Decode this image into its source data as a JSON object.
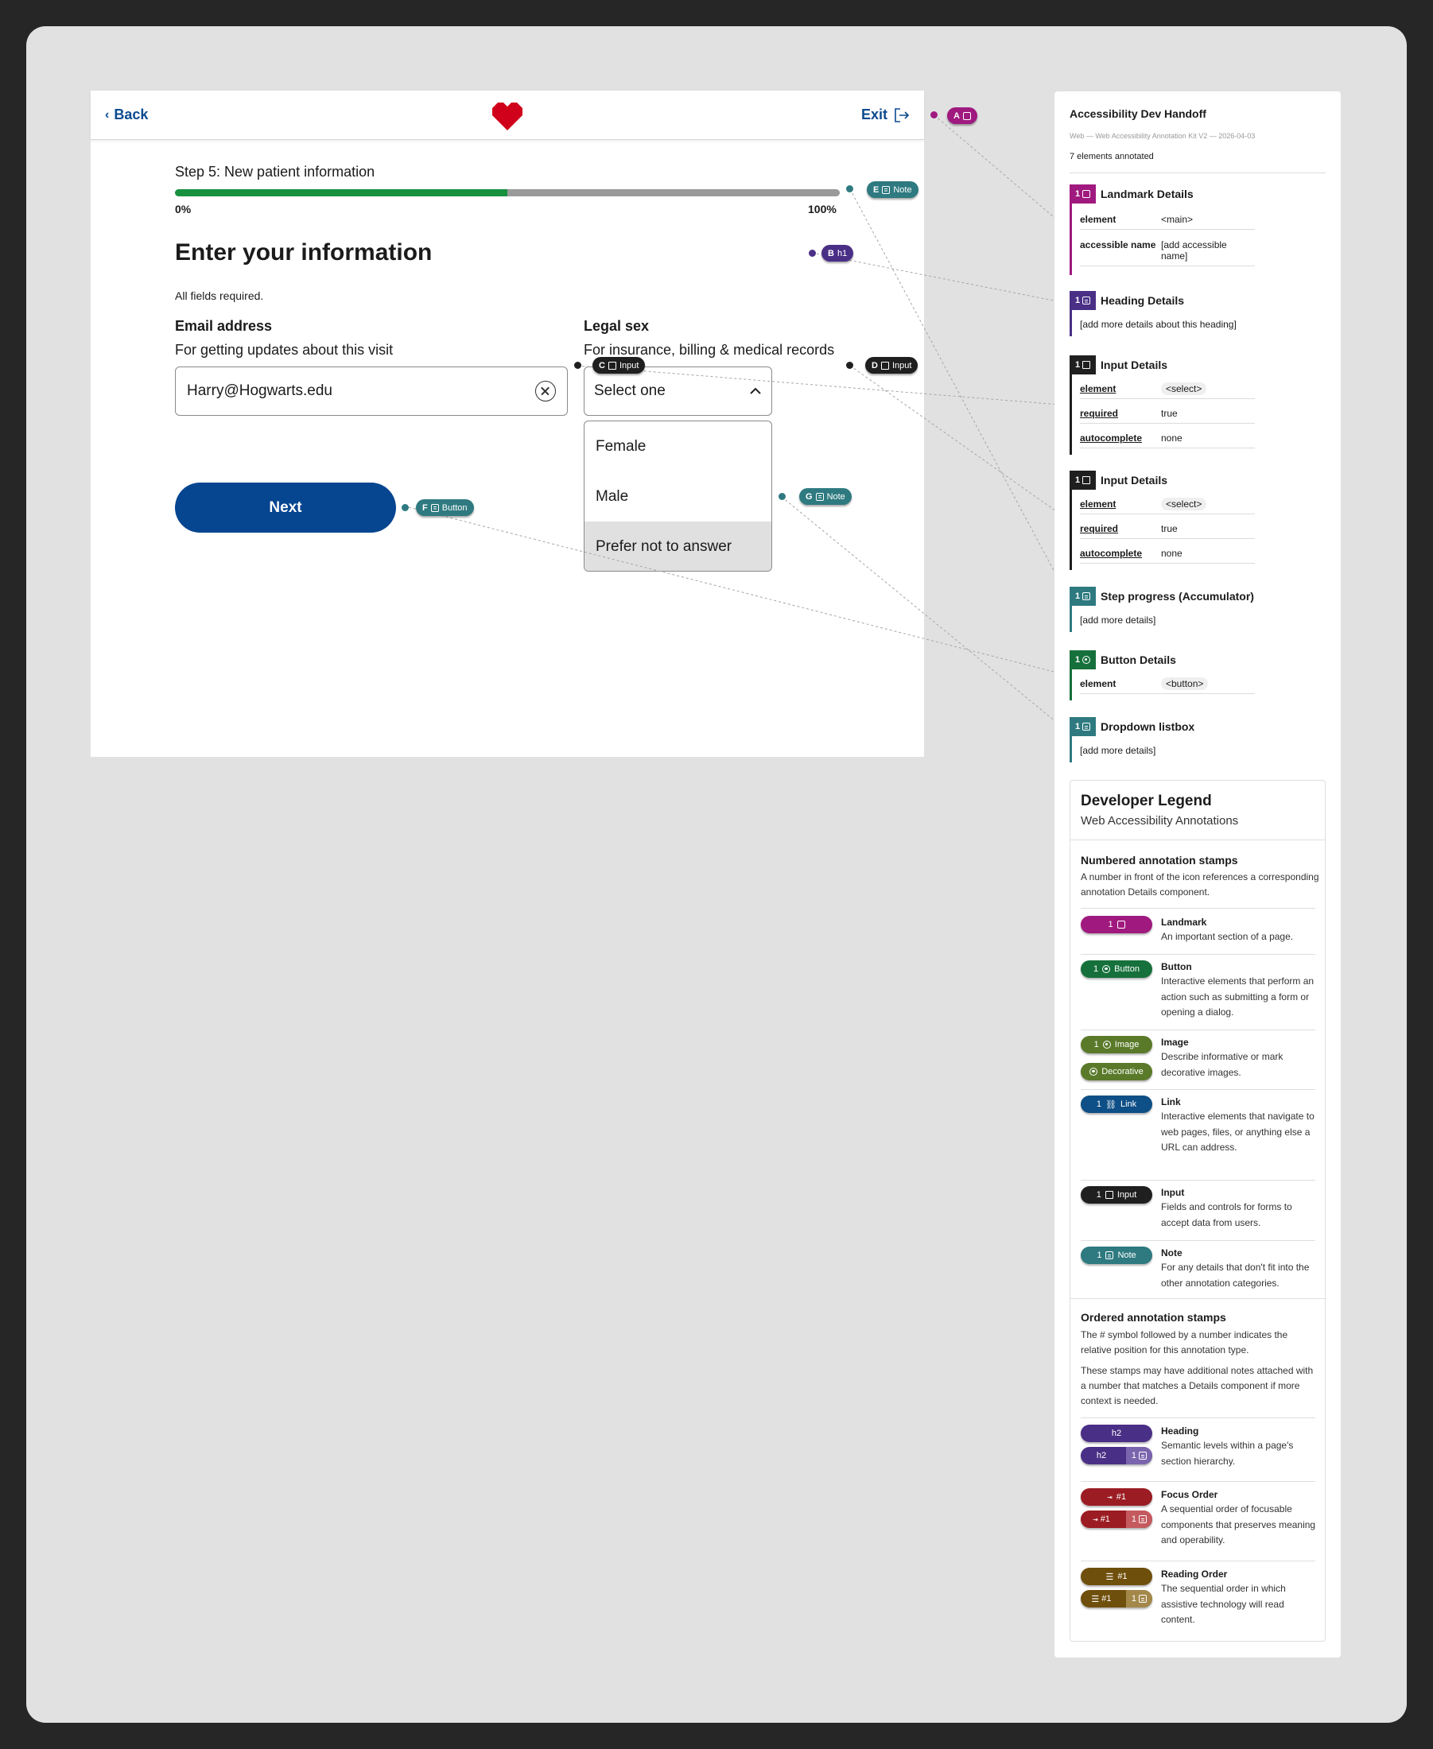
{
  "mock": {
    "back_label": "Back",
    "exit_label": "Exit",
    "step_title": "Step 5: New patient information",
    "progress": 0.5,
    "progress_start": "0%",
    "progress_end": "100%",
    "heading": "Enter your information",
    "required_note": "All fields required.",
    "email": {
      "label": "Email address",
      "hint": "For getting updates about this visit",
      "value": "Harry@Hogwarts.edu"
    },
    "sex": {
      "label": "Legal sex",
      "hint": "For insurance, billing & medical records",
      "selected": "Select one",
      "options": [
        "Female",
        "Male",
        "Prefer not to answer"
      ]
    },
    "next_label": "Next",
    "brand_color": "#d0021b",
    "accent_color": "#064590"
  },
  "stamps": {
    "a": "A",
    "e": {
      "letter": "E",
      "label": "Note"
    },
    "b": {
      "letter": "B",
      "label": "h1"
    },
    "c": {
      "letter": "C",
      "label": "Input"
    },
    "d": {
      "letter": "D",
      "label": "Input"
    },
    "g": {
      "letter": "G",
      "label": "Note"
    },
    "f": {
      "letter": "F",
      "label": "Button"
    }
  },
  "panel": {
    "title": "Accessibility Dev Handoff",
    "subtitle": "Web — Web Accessibility Annotation Kit V2 — 2026-04-03",
    "count": "7 elements annotated",
    "details": [
      {
        "num": "1",
        "title": "Landmark Details",
        "color": "#a0197f",
        "rows": [
          {
            "k": "element",
            "v": "<main>"
          },
          {
            "k": "accessible name",
            "v": "[add accessible name]"
          }
        ]
      },
      {
        "num": "1",
        "title": "Heading Details",
        "color": "#4a2f86",
        "text": "[add more details about this heading]"
      },
      {
        "num": "1",
        "title": "Input Details",
        "color": "#1f1f1f",
        "rows": [
          {
            "k": "element",
            "v": "<select>"
          },
          {
            "k": "required",
            "v": "true"
          },
          {
            "k": "autocomplete",
            "v": "none"
          }
        ]
      },
      {
        "num": "1",
        "title": "Input Details",
        "color": "#1f1f1f",
        "rows": [
          {
            "k": "element",
            "v": "<select>"
          },
          {
            "k": "required",
            "v": "true"
          },
          {
            "k": "autocomplete",
            "v": "none"
          }
        ]
      },
      {
        "num": "1",
        "title": "Step progress (Accumulator)",
        "color": "#2e7a80",
        "text": "[add more details]"
      },
      {
        "num": "1",
        "title": "Button Details",
        "color": "#16703b",
        "rows": [
          {
            "k": "element",
            "v": "<button>"
          }
        ]
      },
      {
        "num": "1",
        "title": "Dropdown listbox",
        "color": "#2e7a80",
        "text": "[add more details]"
      }
    ]
  },
  "legend": {
    "title": "Developer Legend",
    "subtitle": "Web Accessibility Annotations",
    "numbered_title": "Numbered annotation stamps",
    "numbered_text": "A number in front of the icon references a corresponding annotation Details component.",
    "items": [
      {
        "stamp": "1",
        "stamp_label": "",
        "label": "Landmark",
        "desc": "An important section of a page.",
        "color": "#a0197f"
      },
      {
        "stamp": "1",
        "stamp_label": "Button",
        "label": "Button",
        "desc": "Interactive elements that perform an action such as submitting a form or opening a dialog.",
        "color": "#16703b"
      },
      {
        "stamp": "1",
        "stamp_label": "Image",
        "stamp2": "Decorative",
        "label": "Image",
        "desc": "Describe informative or mark decorative images.",
        "color": "#5a7a2a"
      },
      {
        "stamp": "1",
        "stamp_label": "Link",
        "label": "Link",
        "desc": "Interactive elements that navigate to web pages, files, or anything else a URL can address.",
        "color": "#0d4f86"
      },
      {
        "stamp": "1",
        "stamp_label": "Input",
        "label": "Input",
        "desc": "Fields and controls for forms to accept data from users.",
        "color": "#1f1f1f"
      },
      {
        "stamp": "1",
        "stamp_label": "Note",
        "label": "Note",
        "desc": "For any details that don't fit into the other annotation categories.",
        "color": "#2e7a80"
      }
    ],
    "ordered_title": "Ordered annotation stamps",
    "ordered_text1": "The # symbol followed by a number indicates the relative position for this annotation type.",
    "ordered_text2": "These stamps may have additional notes attached with a number that matches a Details component if more context is needed.",
    "ordered_items": [
      {
        "stamp": "h2",
        "stamp2a": "h2",
        "stamp2b": "1",
        "label": "Heading",
        "desc": "Semantic levels within a page's section hierarchy.",
        "color": "#4a2f86",
        "color2": "#7a64ad"
      },
      {
        "stamp": "#1",
        "stamp2a": "#1",
        "stamp2b": "1",
        "label": "Focus Order",
        "desc": "A sequential order of focusable components that preserves meaning and operability.",
        "color": "#9b1c22",
        "color2": "#c45a5e"
      },
      {
        "stamp": "#1",
        "stamp2a": "#1",
        "stamp2b": "1",
        "label": "Reading Order",
        "desc": "The sequential order in which assistive technology will read content.",
        "color": "#6f4f0c",
        "color2": "#a3884a"
      }
    ]
  }
}
